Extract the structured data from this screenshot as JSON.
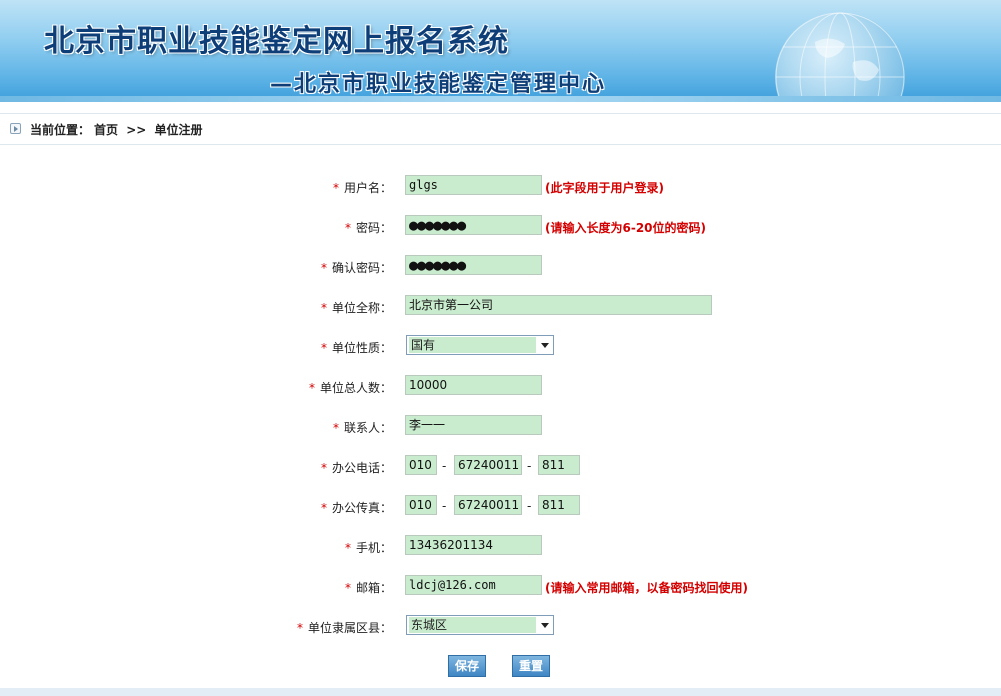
{
  "header": {
    "title": "北京市职业技能鉴定网上报名系统",
    "subtitle": "—北京市职业技能鉴定管理中心"
  },
  "breadcrumb": {
    "prefix": "当前位置：",
    "home": "首页",
    "sep": ">>",
    "current": "单位注册"
  },
  "form": {
    "required_mark": "*",
    "username": {
      "label": "用户名：",
      "value": "glgs",
      "hint": "(此字段用于用户登录)"
    },
    "password": {
      "label": "密码：",
      "value": "●●●●●●●",
      "hint": "(请输入长度为6-20位的密码)"
    },
    "confirm_password": {
      "label": "确认密码：",
      "value": "●●●●●●●"
    },
    "company_name": {
      "label": "单位全称：",
      "value": "北京市第一公司"
    },
    "company_type": {
      "label": "单位性质：",
      "value": "国有"
    },
    "employee_count": {
      "label": "单位总人数：",
      "value": "10000"
    },
    "contact": {
      "label": "联系人：",
      "value": "李一一"
    },
    "office_phone": {
      "label": "办公电话：",
      "area": "010",
      "number": "67240011",
      "ext": "811"
    },
    "office_fax": {
      "label": "办公传真：",
      "area": "010",
      "number": "67240011",
      "ext": "811"
    },
    "mobile": {
      "label": "手机：",
      "value": "13436201134"
    },
    "email": {
      "label": "邮箱：",
      "value": "ldcj@126.com",
      "hint": "(请输入常用邮箱，以备密码找回使用)"
    },
    "district": {
      "label": "单位隶属区县：",
      "value": "东城区"
    },
    "dash": "-"
  },
  "buttons": {
    "save": "保存",
    "reset": "重置"
  },
  "colors": {
    "input_bg": "#c9ecce",
    "hint": "#d40000",
    "button": "#3f86c4",
    "banner": "#5fb4e6"
  }
}
